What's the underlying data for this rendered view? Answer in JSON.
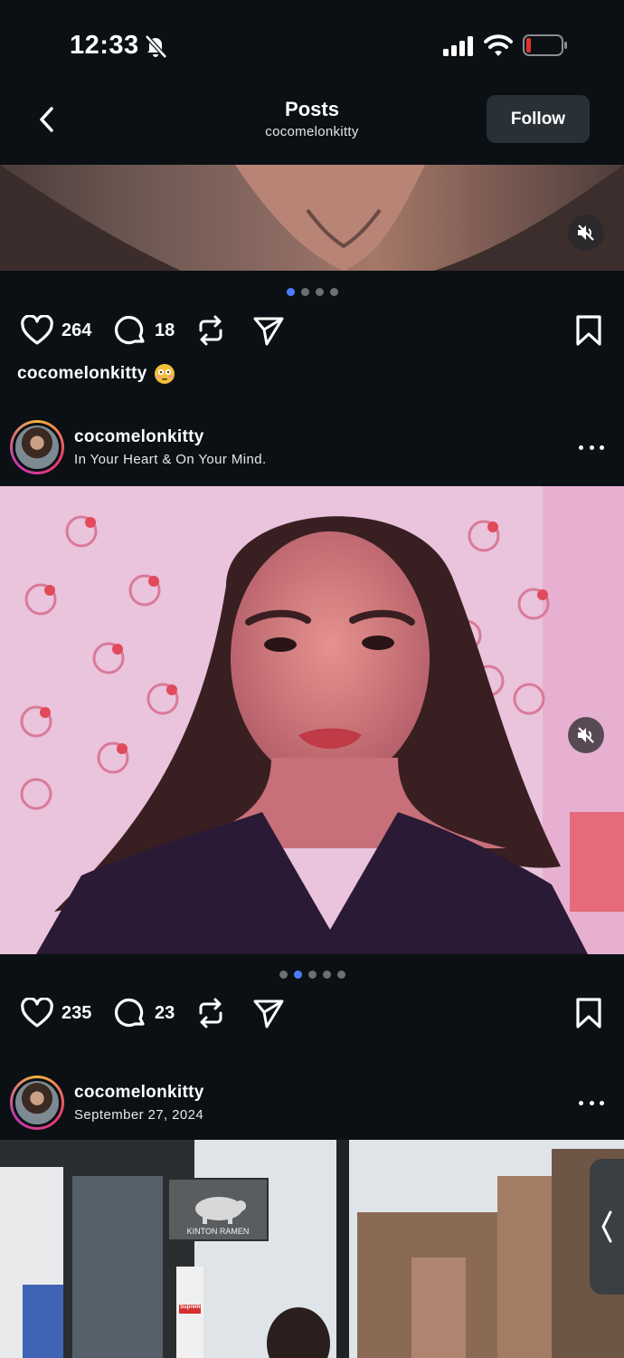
{
  "status_bar": {
    "time": "12:33"
  },
  "header": {
    "title": "Posts",
    "username": "cocomelonkitty",
    "follow_label": "Follow"
  },
  "posts": [
    {
      "likes": "264",
      "comments": "18",
      "caption_user": "cocomelonkitty",
      "carousel_count": 4,
      "carousel_active": 0
    },
    {
      "username": "cocomelonkitty",
      "subtitle": "In Your Heart & On Your Mind.",
      "likes": "235",
      "comments": "23",
      "carousel_count": 5,
      "carousel_active": 1
    },
    {
      "username": "cocomelonkitty",
      "subtitle": "September 27, 2024",
      "sign_text": "KINTON RAMEN",
      "store_text": "Supreme"
    }
  ],
  "colors": {
    "background": "#0b1014",
    "accent_dot": "#4c7dff",
    "battery_low": "#e5302b"
  }
}
